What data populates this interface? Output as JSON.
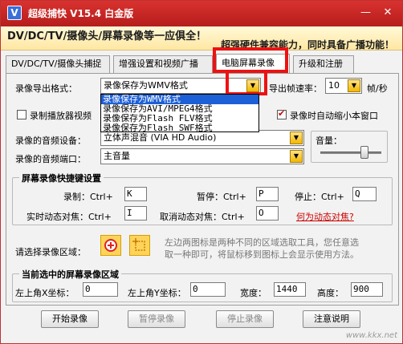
{
  "window": {
    "title": "超级捕快 V15.4 白金版",
    "app_icon": "V",
    "minimize": "—",
    "close": "✕"
  },
  "banner": {
    "line1": "DV/DC/TV/摄像头/屏幕录像等一应俱全！",
    "line2": "超强硬件兼容能力，同时具备广播功能！"
  },
  "tabs": [
    {
      "label": "DV/DC/TV/摄像头捕捉"
    },
    {
      "label": "增强设置和视频广播"
    },
    {
      "label": "电脑屏幕录像"
    },
    {
      "label": "升级和注册"
    }
  ],
  "export_format": {
    "label": "录像导出格式：",
    "value": "录像保存为WMV格式",
    "options": [
      "录像保存为WMV格式",
      "录像保存为AVI/MPEG4格式",
      "录像保存为Flash FLV格式",
      "录像保存为Flash SWF格式"
    ]
  },
  "frame_rate": {
    "label": "导出帧速率：",
    "value": "10",
    "unit": "帧/秒"
  },
  "record_player_video": "录制播放器视频",
  "auto_minimize": "录像时自动缩小本窗口",
  "audio_device": {
    "label": "录像的音频设备：",
    "value": "立体声混音 (VIA HD Audio)"
  },
  "audio_port": {
    "label": "录像的音频端口：",
    "value": "主音量"
  },
  "volume_label": "音量：",
  "volume_level": 0.72,
  "hotkeys": {
    "title": "屏幕录像快捷键设置",
    "record_label": "录制：Ctrl+",
    "record_key": "K",
    "pause_label": "暂停：Ctrl+",
    "pause_key": "P",
    "stop_label": "停止：Ctrl+",
    "stop_key": "Q",
    "focus_label": "实时动态对焦：Ctrl+",
    "focus_key": "I",
    "cancel_focus_label": "取消动态对焦：Ctrl+",
    "cancel_focus_key": "O",
    "focus_help_link": "何为动态对焦?"
  },
  "region": {
    "label": "请选择录像区域：",
    "hint_line1": "左边两图标是两种不同的区域选取工具，您任意选",
    "hint_line2": "取一种即可，将鼠标移到图标上会显示使用方法。"
  },
  "current_region": {
    "title": "当前选中的屏幕录像区域",
    "x_label": "左上角X坐标：",
    "x_value": "0",
    "y_label": "左上角Y坐标：",
    "y_value": "0",
    "width_label": "宽度：",
    "width_value": "1440",
    "height_label": "高度：",
    "height_value": "900"
  },
  "buttons": {
    "start": "开始录像",
    "pause": "暂停录像",
    "stop": "停止录像",
    "help": "注意说明"
  },
  "watermark": "www.kkx.net"
}
